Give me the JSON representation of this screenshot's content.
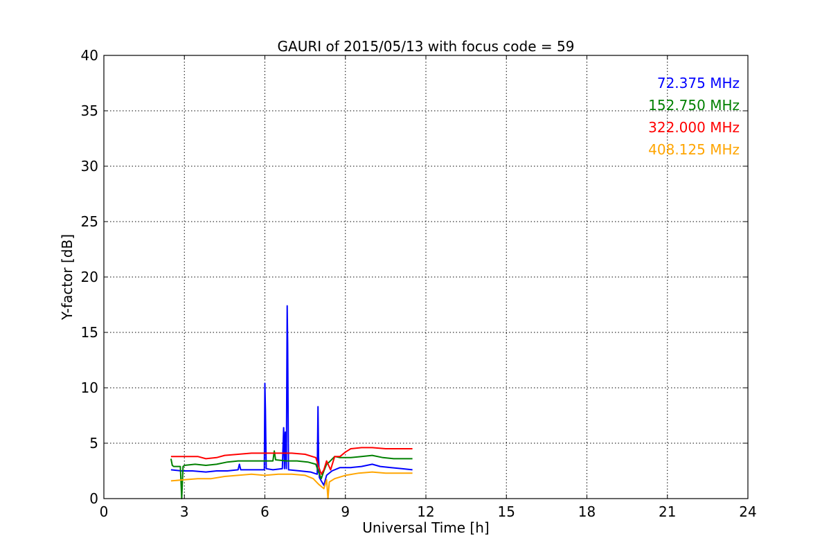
{
  "chart_data": {
    "type": "line",
    "title": "GAURI of 2015/05/13 with focus code = 59",
    "xlabel": "Universal Time [h]",
    "ylabel": "Y-factor [dB]",
    "xlim": [
      0,
      24
    ],
    "ylim": [
      0,
      40
    ],
    "xticks": [
      0,
      3,
      6,
      9,
      12,
      15,
      18,
      21,
      24
    ],
    "yticks": [
      0,
      5,
      10,
      15,
      20,
      25,
      30,
      35,
      40
    ],
    "grid": true,
    "legend_position": "top-right",
    "series": [
      {
        "name": "72.375 MHz",
        "color": "#0000ff",
        "x": [
          2.5,
          2.9,
          3.3,
          3.8,
          4.2,
          4.6,
          5.0,
          5.05,
          5.1,
          5.5,
          5.98,
          6.0,
          6.02,
          6.05,
          6.3,
          6.65,
          6.7,
          6.73,
          6.76,
          6.8,
          6.83,
          6.85,
          6.88,
          7.3,
          7.7,
          7.95,
          7.98,
          8.0,
          8.03,
          8.1,
          8.2,
          8.3,
          8.5,
          8.8,
          9.2,
          9.6,
          10.0,
          10.3,
          10.7,
          11.1,
          11.5
        ],
        "y": [
          2.6,
          2.5,
          2.5,
          2.4,
          2.5,
          2.5,
          2.6,
          3.1,
          2.6,
          2.6,
          2.6,
          10.4,
          8.0,
          2.7,
          2.6,
          2.7,
          6.4,
          2.7,
          6.0,
          2.7,
          17.4,
          14.0,
          2.6,
          2.5,
          2.4,
          2.2,
          8.3,
          3.8,
          1.9,
          1.6,
          1.2,
          2.1,
          2.5,
          2.8,
          2.8,
          2.9,
          3.1,
          2.9,
          2.8,
          2.7,
          2.6
        ]
      },
      {
        "name": "152.750 MHz",
        "color": "#008000",
        "x": [
          2.5,
          2.55,
          2.6,
          2.85,
          2.9,
          2.95,
          3.0,
          3.4,
          3.8,
          4.2,
          4.6,
          5.0,
          5.5,
          6.0,
          6.3,
          6.35,
          6.4,
          6.8,
          7.2,
          7.6,
          7.9,
          8.0,
          8.1,
          8.2,
          8.3,
          8.4,
          8.6,
          8.8,
          9.2,
          9.6,
          10.0,
          10.4,
          10.8,
          11.2,
          11.5
        ],
        "y": [
          3.6,
          3.0,
          2.9,
          2.9,
          0.0,
          2.9,
          3.0,
          3.1,
          3.0,
          3.1,
          3.3,
          3.4,
          3.4,
          3.4,
          3.4,
          4.3,
          3.5,
          3.4,
          3.4,
          3.3,
          3.1,
          2.4,
          1.8,
          2.5,
          3.1,
          3.3,
          3.8,
          3.7,
          3.7,
          3.8,
          3.9,
          3.7,
          3.6,
          3.6,
          3.6
        ]
      },
      {
        "name": "322.000 MHz",
        "color": "#ff0000",
        "x": [
          2.5,
          3.0,
          3.5,
          3.8,
          4.2,
          4.5,
          5.0,
          5.5,
          6.0,
          6.5,
          7.0,
          7.5,
          7.9,
          8.0,
          8.1,
          8.2,
          8.3,
          8.45,
          8.6,
          8.8,
          9.0,
          9.2,
          9.6,
          10.0,
          10.5,
          11.0,
          11.5
        ],
        "y": [
          3.8,
          3.8,
          3.8,
          3.6,
          3.7,
          3.9,
          4.0,
          4.1,
          4.1,
          4.1,
          4.1,
          4.0,
          3.7,
          2.9,
          2.2,
          2.6,
          3.4,
          2.6,
          3.8,
          3.8,
          4.2,
          4.5,
          4.6,
          4.6,
          4.5,
          4.5,
          4.5
        ]
      },
      {
        "name": "408.125 MHz",
        "color": "#ffa500",
        "x": [
          2.5,
          3.0,
          3.5,
          4.0,
          4.5,
          5.0,
          5.5,
          6.0,
          6.5,
          7.0,
          7.5,
          7.8,
          8.0,
          8.2,
          8.3,
          8.35,
          8.4,
          8.6,
          9.0,
          9.5,
          10.0,
          10.5,
          11.0,
          11.5
        ],
        "y": [
          1.6,
          1.7,
          1.8,
          1.8,
          2.0,
          2.1,
          2.2,
          2.1,
          2.2,
          2.2,
          2.1,
          1.8,
          1.3,
          0.9,
          1.7,
          0.0,
          1.5,
          1.8,
          2.1,
          2.3,
          2.4,
          2.3,
          2.3,
          2.3
        ]
      }
    ]
  }
}
